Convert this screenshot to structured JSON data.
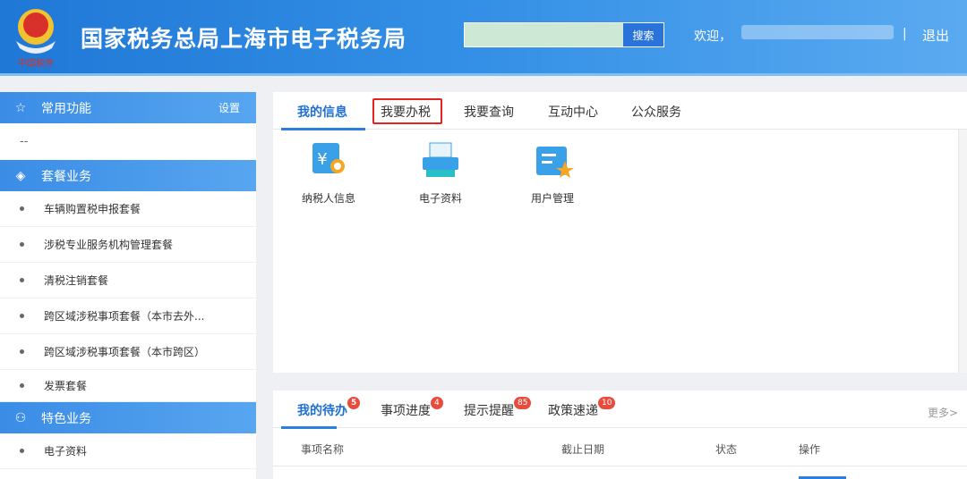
{
  "header": {
    "title": "国家税务总局上海市电子税务局",
    "logo_text": "中国税务",
    "search_placeholder": "",
    "search_button": "搜索",
    "welcome": "欢迎，",
    "separator": "|",
    "logout": "退出"
  },
  "sidebar": {
    "sections": [
      {
        "label": "常用功能",
        "action": "设置",
        "items": [
          "--"
        ]
      },
      {
        "label": "套餐业务",
        "items": [
          "车辆购置税申报套餐",
          "涉税专业服务机构管理套餐",
          "清税注销套餐",
          "跨区域涉税事项套餐（本市去外...",
          "跨区域涉税事项套餐（本市跨区）",
          "发票套餐"
        ]
      },
      {
        "label": "特色业务",
        "items": [
          "电子资料"
        ]
      }
    ]
  },
  "main": {
    "tabs": [
      "我的信息",
      "我要办税",
      "我要查询",
      "互动中心",
      "公众服务"
    ],
    "tiles": [
      "纳税人信息",
      "电子资料",
      "用户管理"
    ]
  },
  "todo": {
    "tabs": [
      {
        "label": "我的待办",
        "count": "5"
      },
      {
        "label": "事项进度",
        "count": "4"
      },
      {
        "label": "提示提醒",
        "count": "85"
      },
      {
        "label": "政策速递",
        "count": "10"
      }
    ],
    "more": "更多>",
    "columns": [
      "事项名称",
      "截止日期",
      "状态",
      "操作"
    ]
  },
  "colors": {
    "accent": "#2a7fe0",
    "header": "#1f78d6",
    "highlight": "#e52222"
  }
}
